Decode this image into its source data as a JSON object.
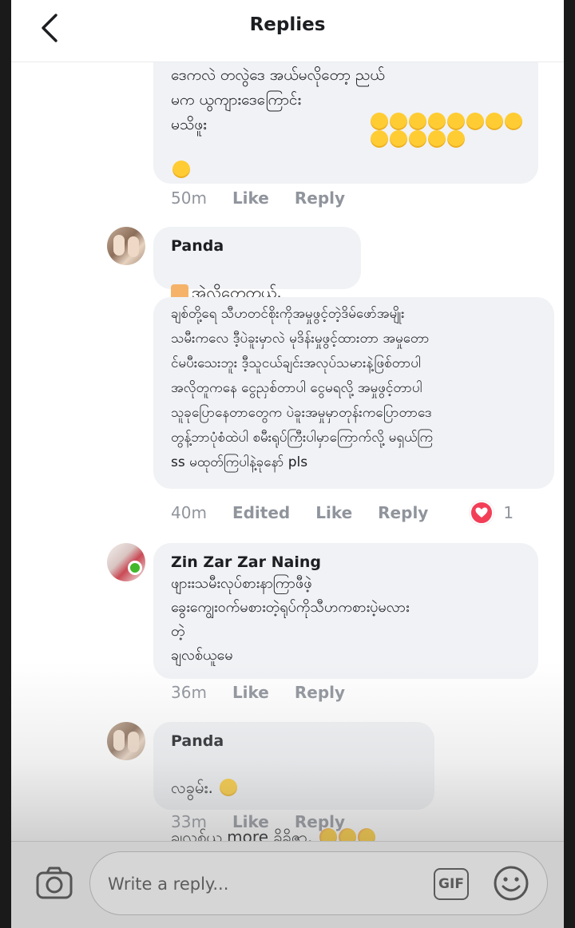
{
  "header": {
    "title": "Replies"
  },
  "comments": [
    {
      "text": "အမ္မဒုန်းကျင့်ခရုတ်အရုံကုတ်ပြီ ပြောကတာဘောင်း\nဒေကလဲ တလွဲဒေ အယ်မလိုတော့ ညယ်\nမက ယွကျားဒေကြောင်း\nမသိဖူး",
      "time": "50m",
      "like": "Like",
      "reply": "Reply"
    },
    {
      "name": "Panda",
      "text": "အဲ့လိုတွေ့တယ်.",
      "text2": "ချစ်တို့ရေ သီဟတင်စိုးကိုအမှုဖွင့်တဲ့ဒိမ်ဖော်အမျိုး\nသမီးကလေ ဒီ့ပဲခူးမှာလဲ မုဒိန်းမှုဖွင့်ထားတာ အမှုတော\nင်မပီးသေးဘူး ဒီ့သူငယ်ချင်းအလုပ်သမားနဲ့ဖြစ်တာပါ\nအလိုတူကနေ ငွေညှစ်တာပါ ငွေမရလို့ အမှုဖွင့်တာပါ\nသူခုပြောနေတာတွေက ပဲခူးအမှုမှာတုန်းကပြောတာဒေ\nတွန့်ဘာပုံစံထဲပါ စမီးရုပ်ကြီးပါမှာကြောက်လို့ မရှယ်ကြ\nss မထုတ်ကြပါနဲ့ခုနော် pls",
      "time": "40m",
      "edited": "Edited",
      "like": "Like",
      "reply": "Reply",
      "reaction_count": "1"
    },
    {
      "name": "Zin Zar Zar Naing",
      "text": "ဖျားးသမီးလုပ်စားနာကြာဖီဖဲ့\nခွေးကျွေးဝက်မစားတဲ့ရုပ်ကိုသီဟကစားပဲ့မလား\nတဲ့\nချလစ်ယူမေ",
      "time": "36m",
      "like": "Like",
      "reply": "Reply"
    },
    {
      "name": "Panda",
      "text": "လခွမ်း.",
      "text2": "ချလစ်ယူ more ခိုခိုဇာ.",
      "time": "33m",
      "like": "Like",
      "reply": "Reply"
    }
  ],
  "composer": {
    "placeholder": "Write a reply...",
    "gif_label": "GIF"
  },
  "colors": {
    "bubble": "#f0f2f5",
    "meta": "#90949c",
    "heart": "#f33e58",
    "online": "#42b72a"
  }
}
